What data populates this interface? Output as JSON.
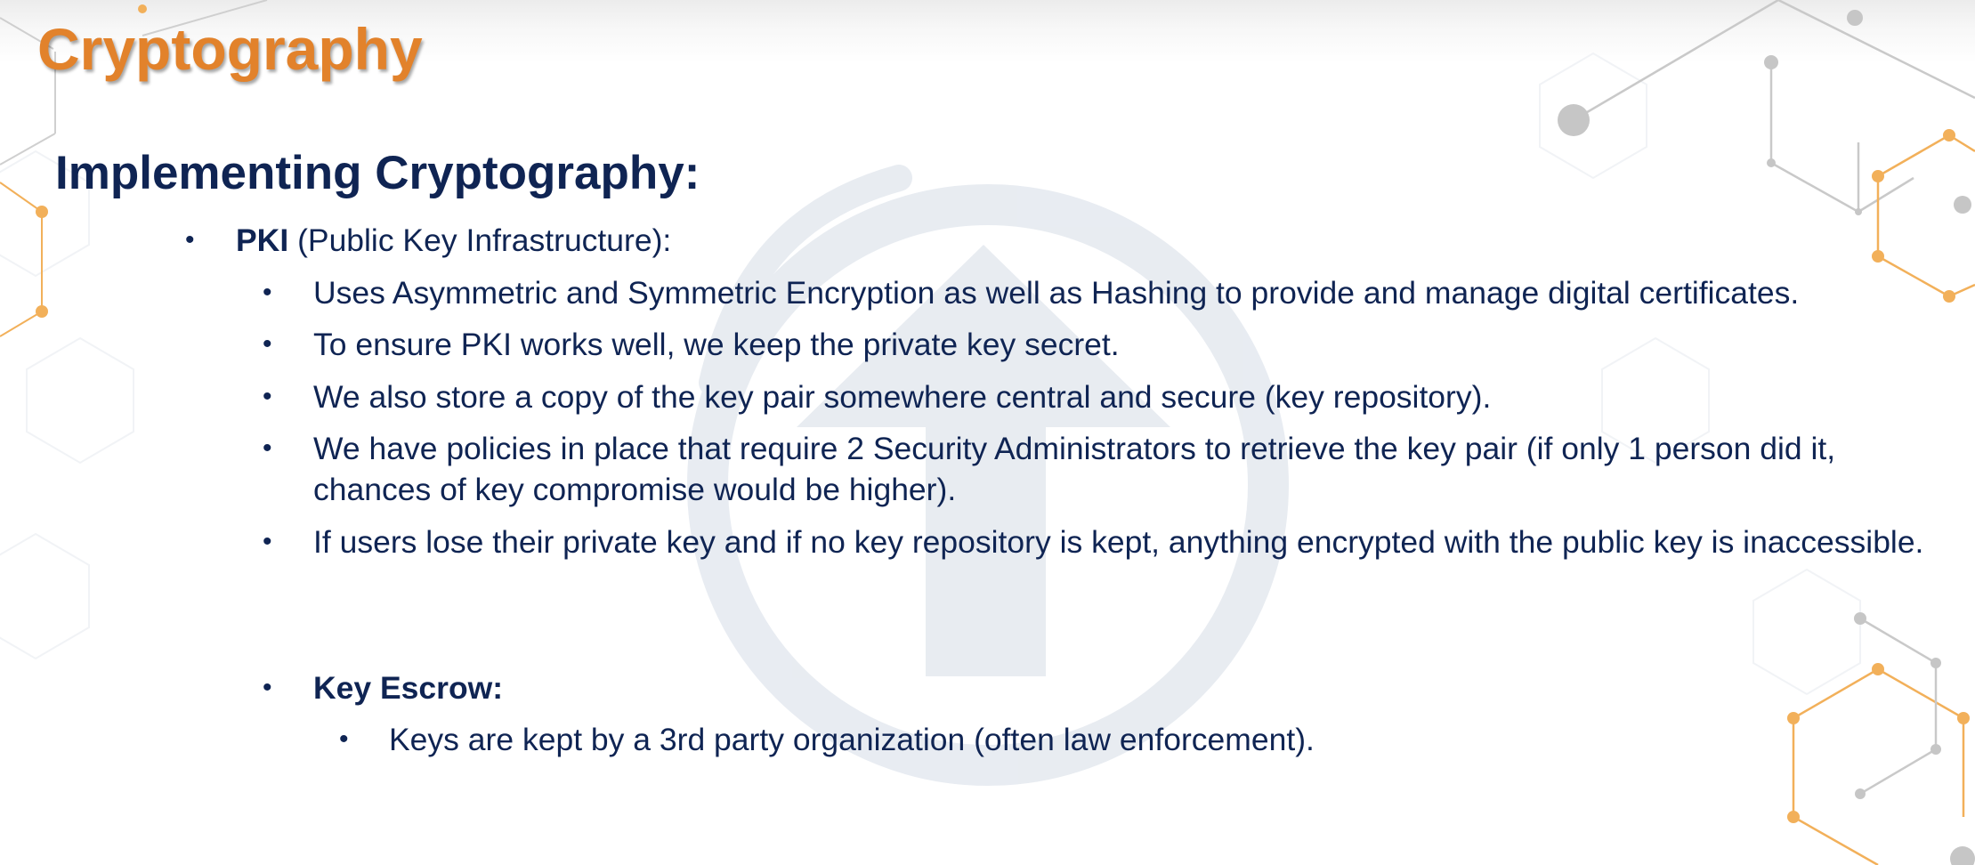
{
  "slide": {
    "title": "Cryptography",
    "heading": "Implementing Cryptography:"
  },
  "content": {
    "pki": {
      "term": "PKI",
      "description": "(Public Key Infrastructure):",
      "points": [
        "Uses Asymmetric and Symmetric Encryption as well as Hashing to provide and manage digital certificates.",
        "To ensure PKI works well, we keep the private key secret.",
        "We also store a copy of the key pair somewhere central and secure (key repository).",
        "We have policies in place that require 2 Security Administrators to retrieve the key pair (if only 1 person did it, chances of key compromise would be higher).",
        "If users lose their private key and if no key repository is kept, anything encrypted with the public key is inaccessible."
      ]
    },
    "key_escrow": {
      "term": "Key Escrow:",
      "points": [
        "Keys are kept by a 3rd party organization (often law enforcement)."
      ]
    }
  },
  "bullet_glyph": "•",
  "colors": {
    "title": "#e2822b",
    "text": "#0f2453",
    "watermark": "#e7ebf1",
    "node_gray": "#c6c6c6",
    "node_orange": "#f2b05a"
  }
}
